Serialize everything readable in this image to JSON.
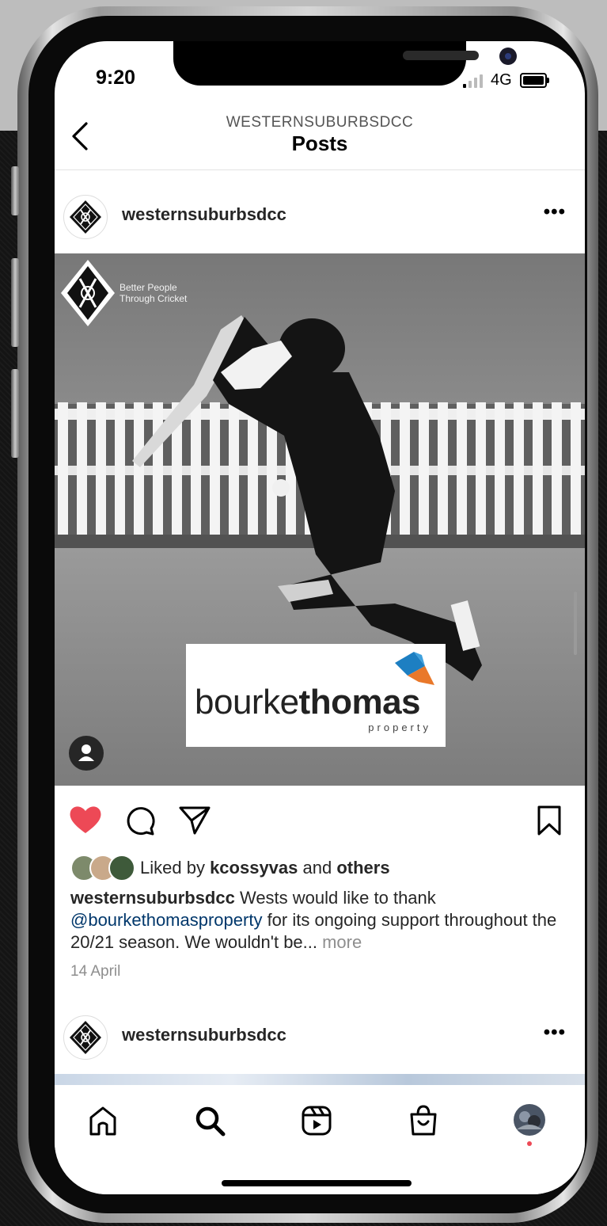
{
  "status_bar": {
    "time": "9:20",
    "network": "4G"
  },
  "header": {
    "account": "WESTERNSUBURBSDCC",
    "title": "Posts"
  },
  "post": {
    "username": "westernsuburbsdcc",
    "image": {
      "club_tagline_line1": "Better People",
      "club_tagline_line2": "Through Cricket",
      "club_initials": [
        "W",
        "S",
        "C",
        "C",
        "D"
      ],
      "sponsor_name_light": "bourke",
      "sponsor_name_bold": "thomas",
      "sponsor_subtitle": "property"
    },
    "liked": true,
    "likes": {
      "prefix": "Liked by ",
      "user": "kcossyvas",
      "middle": " and ",
      "others": "others"
    },
    "caption": {
      "username": "westernsuburbsdcc",
      "text_part1": " Wests would like to thank ",
      "mention": "@bourkethomasproperty",
      "text_part2": " for its ongoing support throughout the 20/21 season. We wouldn't be... ",
      "more": "more"
    },
    "date": "14 April"
  },
  "next_post": {
    "username": "westernsuburbsdcc"
  },
  "tab_bar": {
    "items": [
      "home-icon",
      "search-icon",
      "reels-icon",
      "shop-icon",
      "profile-avatar"
    ]
  },
  "colors": {
    "like_red": "#ed4956",
    "mention_blue": "#00376b",
    "muted_gray": "#8e8e8e",
    "sponsor_blue": "#1d7fc2",
    "sponsor_orange": "#e9782a"
  }
}
